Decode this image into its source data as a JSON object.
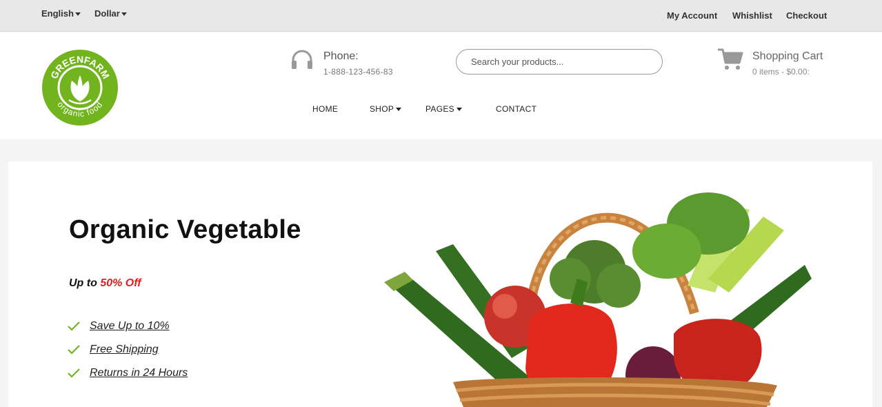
{
  "topbar": {
    "language": "English",
    "currency": "Dollar",
    "links": [
      "My Account",
      "Whishlist",
      "Checkout"
    ]
  },
  "header": {
    "logo": {
      "brand": "GREENFARM",
      "tagline": "organic food",
      "color": "#72b41e"
    },
    "phone": {
      "title": "Phone:",
      "number": "1-888-123-456-83"
    },
    "search": {
      "placeholder": "Search your products..."
    },
    "cart": {
      "title": "Shopping Cart",
      "summary": "0 items - $0.00:"
    }
  },
  "nav": {
    "items": [
      {
        "label": "HOME"
      },
      {
        "label": "SHOP"
      },
      {
        "label": "PAGES"
      },
      {
        "label": "CONTACT"
      }
    ]
  },
  "hero": {
    "title": "Organic Vegetable",
    "offer_prefix": "Up to",
    "offer_highlight": "50% Off",
    "highlight_color": "#e31e1e",
    "check_color": "#72b41e",
    "features": [
      "Save Up to 10%",
      "Free Shipping",
      "Returns in 24 Hours"
    ]
  }
}
